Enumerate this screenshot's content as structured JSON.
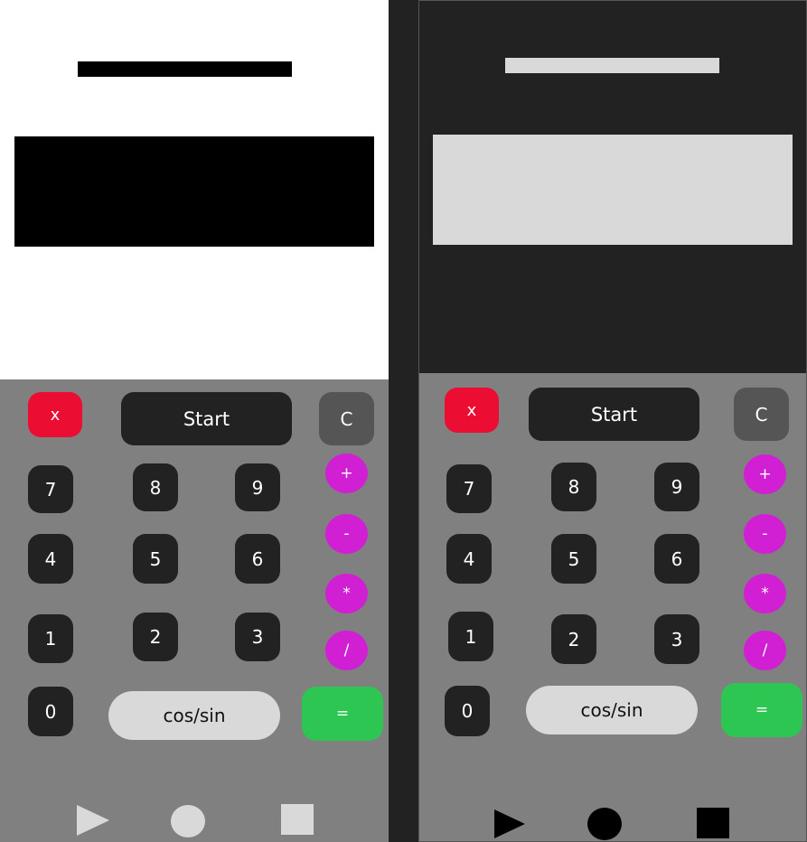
{
  "screens": [
    {
      "theme": "light",
      "colors": {
        "display_bg": "#ffffff",
        "result_bar": "#000000",
        "nav_icons": "#d9d9d9"
      },
      "buttons": {
        "cancel": "x",
        "start": "Start",
        "clear": "C",
        "digits": [
          "7",
          "8",
          "9",
          "4",
          "5",
          "6",
          "1",
          "2",
          "3",
          "0"
        ],
        "ops": [
          "+",
          "-",
          "*",
          "/"
        ],
        "func": "cos/sin",
        "equals": "="
      },
      "nav": [
        "back-triangle-icon",
        "home-circle-icon",
        "recents-square-icon"
      ]
    },
    {
      "theme": "dark",
      "colors": {
        "display_bg": "#222222",
        "result_bar": "#d9d9d9",
        "nav_icons": "#000000"
      },
      "buttons": {
        "cancel": "x",
        "start": "Start",
        "clear": "C",
        "digits": [
          "7",
          "8",
          "9",
          "4",
          "5",
          "6",
          "1",
          "2",
          "3",
          "0"
        ],
        "ops": [
          "+",
          "-",
          "*",
          "/"
        ],
        "func": "cos/sin",
        "equals": "="
      },
      "nav": [
        "back-triangle-icon",
        "home-circle-icon",
        "recents-square-icon"
      ]
    }
  ],
  "colors": {
    "keypad_bg": "#808080",
    "digit_key": "#222222",
    "operator_key": "#d11fd4",
    "cancel_key": "#ec0d33",
    "clear_key": "#555555",
    "equals_key": "#2ec652",
    "func_key": "#d9d9d9"
  }
}
